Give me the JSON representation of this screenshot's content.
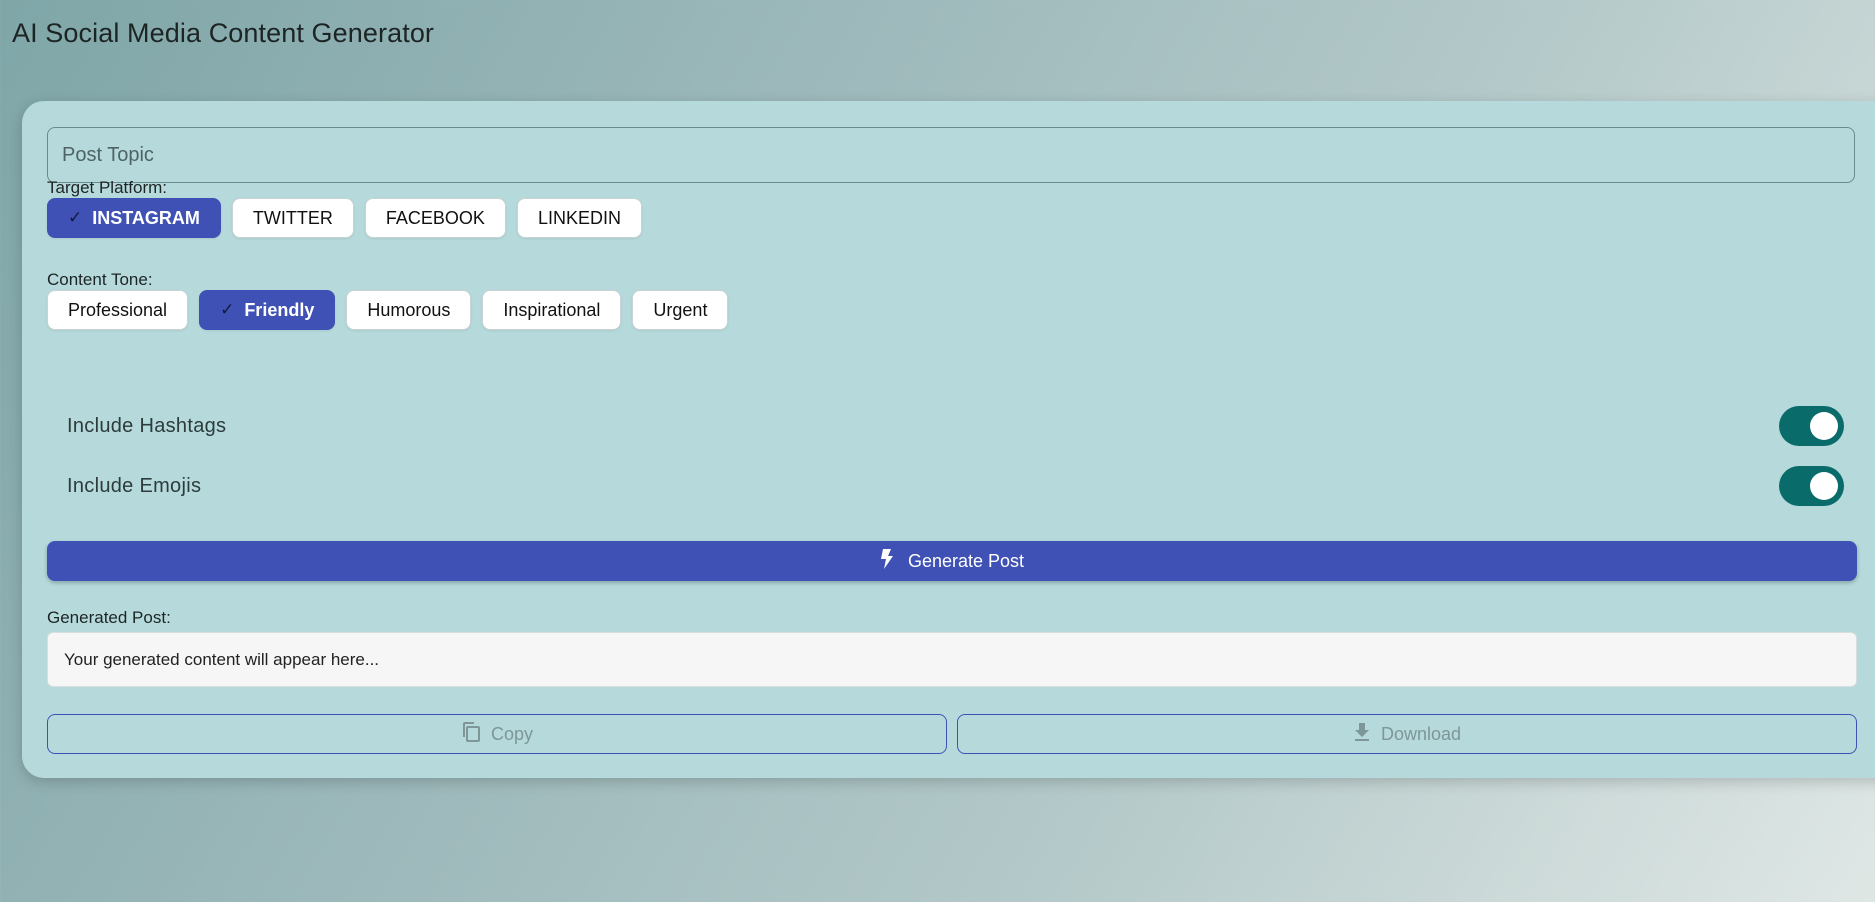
{
  "app": {
    "title": "AI Social Media Content Generator"
  },
  "form": {
    "topic_placeholder": "Post Topic",
    "topic_value": "",
    "platform_label": "Target Platform:",
    "platforms": [
      {
        "label": "INSTAGRAM",
        "selected": true
      },
      {
        "label": "TWITTER",
        "selected": false
      },
      {
        "label": "FACEBOOK",
        "selected": false
      },
      {
        "label": "LINKEDIN",
        "selected": false
      }
    ],
    "tone_label": "Content Tone:",
    "tones": [
      {
        "label": "Professional",
        "selected": false
      },
      {
        "label": "Friendly",
        "selected": true
      },
      {
        "label": "Humorous",
        "selected": false
      },
      {
        "label": "Inspirational",
        "selected": false
      },
      {
        "label": "Urgent",
        "selected": false
      }
    ],
    "toggles": {
      "hashtags": {
        "label": "Include Hashtags",
        "on": true
      },
      "emojis": {
        "label": "Include Emojis",
        "on": true
      }
    },
    "generate_label": "Generate Post"
  },
  "output": {
    "label": "Generated Post:",
    "placeholder": "Your generated content will appear here...",
    "copy_label": "Copy",
    "download_label": "Download"
  },
  "icons": {
    "check": "check-icon",
    "generate": "bolt-icon",
    "copy": "copy-icon",
    "download": "download-icon"
  },
  "colors": {
    "primary": "#3f51b5",
    "toggle_on": "#0a6b6b",
    "card_bg": "#b6dadc",
    "disabled_text": "#7e9697"
  }
}
